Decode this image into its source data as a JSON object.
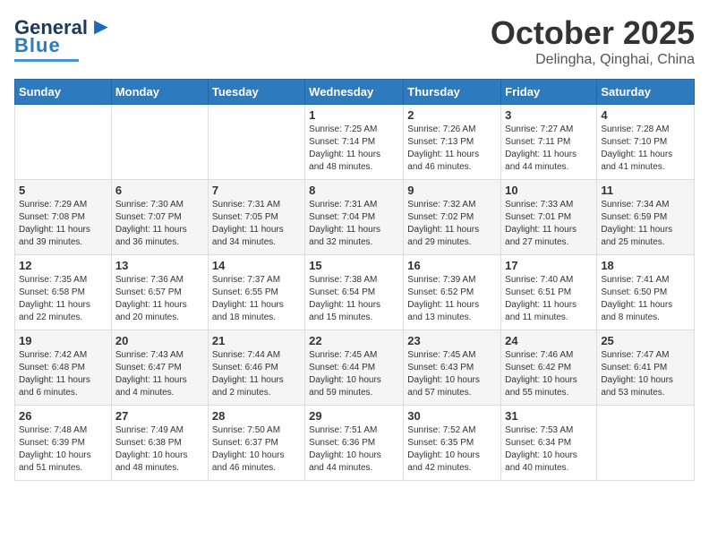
{
  "logo": {
    "line1": "General",
    "line2": "Blue"
  },
  "title": "October 2025",
  "subtitle": "Delingha, Qinghai, China",
  "days_of_week": [
    "Sunday",
    "Monday",
    "Tuesday",
    "Wednesday",
    "Thursday",
    "Friday",
    "Saturday"
  ],
  "weeks": [
    [
      {
        "day": "",
        "info": ""
      },
      {
        "day": "",
        "info": ""
      },
      {
        "day": "",
        "info": ""
      },
      {
        "day": "1",
        "info": "Sunrise: 7:25 AM\nSunset: 7:14 PM\nDaylight: 11 hours\nand 48 minutes."
      },
      {
        "day": "2",
        "info": "Sunrise: 7:26 AM\nSunset: 7:13 PM\nDaylight: 11 hours\nand 46 minutes."
      },
      {
        "day": "3",
        "info": "Sunrise: 7:27 AM\nSunset: 7:11 PM\nDaylight: 11 hours\nand 44 minutes."
      },
      {
        "day": "4",
        "info": "Sunrise: 7:28 AM\nSunset: 7:10 PM\nDaylight: 11 hours\nand 41 minutes."
      }
    ],
    [
      {
        "day": "5",
        "info": "Sunrise: 7:29 AM\nSunset: 7:08 PM\nDaylight: 11 hours\nand 39 minutes."
      },
      {
        "day": "6",
        "info": "Sunrise: 7:30 AM\nSunset: 7:07 PM\nDaylight: 11 hours\nand 36 minutes."
      },
      {
        "day": "7",
        "info": "Sunrise: 7:31 AM\nSunset: 7:05 PM\nDaylight: 11 hours\nand 34 minutes."
      },
      {
        "day": "8",
        "info": "Sunrise: 7:31 AM\nSunset: 7:04 PM\nDaylight: 11 hours\nand 32 minutes."
      },
      {
        "day": "9",
        "info": "Sunrise: 7:32 AM\nSunset: 7:02 PM\nDaylight: 11 hours\nand 29 minutes."
      },
      {
        "day": "10",
        "info": "Sunrise: 7:33 AM\nSunset: 7:01 PM\nDaylight: 11 hours\nand 27 minutes."
      },
      {
        "day": "11",
        "info": "Sunrise: 7:34 AM\nSunset: 6:59 PM\nDaylight: 11 hours\nand 25 minutes."
      }
    ],
    [
      {
        "day": "12",
        "info": "Sunrise: 7:35 AM\nSunset: 6:58 PM\nDaylight: 11 hours\nand 22 minutes."
      },
      {
        "day": "13",
        "info": "Sunrise: 7:36 AM\nSunset: 6:57 PM\nDaylight: 11 hours\nand 20 minutes."
      },
      {
        "day": "14",
        "info": "Sunrise: 7:37 AM\nSunset: 6:55 PM\nDaylight: 11 hours\nand 18 minutes."
      },
      {
        "day": "15",
        "info": "Sunrise: 7:38 AM\nSunset: 6:54 PM\nDaylight: 11 hours\nand 15 minutes."
      },
      {
        "day": "16",
        "info": "Sunrise: 7:39 AM\nSunset: 6:52 PM\nDaylight: 11 hours\nand 13 minutes."
      },
      {
        "day": "17",
        "info": "Sunrise: 7:40 AM\nSunset: 6:51 PM\nDaylight: 11 hours\nand 11 minutes."
      },
      {
        "day": "18",
        "info": "Sunrise: 7:41 AM\nSunset: 6:50 PM\nDaylight: 11 hours\nand 8 minutes."
      }
    ],
    [
      {
        "day": "19",
        "info": "Sunrise: 7:42 AM\nSunset: 6:48 PM\nDaylight: 11 hours\nand 6 minutes."
      },
      {
        "day": "20",
        "info": "Sunrise: 7:43 AM\nSunset: 6:47 PM\nDaylight: 11 hours\nand 4 minutes."
      },
      {
        "day": "21",
        "info": "Sunrise: 7:44 AM\nSunset: 6:46 PM\nDaylight: 11 hours\nand 2 minutes."
      },
      {
        "day": "22",
        "info": "Sunrise: 7:45 AM\nSunset: 6:44 PM\nDaylight: 10 hours\nand 59 minutes."
      },
      {
        "day": "23",
        "info": "Sunrise: 7:45 AM\nSunset: 6:43 PM\nDaylight: 10 hours\nand 57 minutes."
      },
      {
        "day": "24",
        "info": "Sunrise: 7:46 AM\nSunset: 6:42 PM\nDaylight: 10 hours\nand 55 minutes."
      },
      {
        "day": "25",
        "info": "Sunrise: 7:47 AM\nSunset: 6:41 PM\nDaylight: 10 hours\nand 53 minutes."
      }
    ],
    [
      {
        "day": "26",
        "info": "Sunrise: 7:48 AM\nSunset: 6:39 PM\nDaylight: 10 hours\nand 51 minutes."
      },
      {
        "day": "27",
        "info": "Sunrise: 7:49 AM\nSunset: 6:38 PM\nDaylight: 10 hours\nand 48 minutes."
      },
      {
        "day": "28",
        "info": "Sunrise: 7:50 AM\nSunset: 6:37 PM\nDaylight: 10 hours\nand 46 minutes."
      },
      {
        "day": "29",
        "info": "Sunrise: 7:51 AM\nSunset: 6:36 PM\nDaylight: 10 hours\nand 44 minutes."
      },
      {
        "day": "30",
        "info": "Sunrise: 7:52 AM\nSunset: 6:35 PM\nDaylight: 10 hours\nand 42 minutes."
      },
      {
        "day": "31",
        "info": "Sunrise: 7:53 AM\nSunset: 6:34 PM\nDaylight: 10 hours\nand 40 minutes."
      },
      {
        "day": "",
        "info": ""
      }
    ]
  ]
}
